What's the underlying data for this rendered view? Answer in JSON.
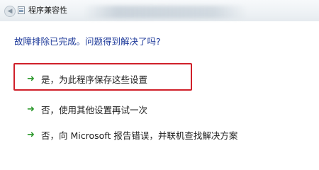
{
  "window": {
    "title": "程序兼容性"
  },
  "dialog": {
    "question": "故障排除已完成。问题得到解决了吗?",
    "options": [
      {
        "label": "是，为此程序保存这些设置",
        "icon": "green-arrow-icon",
        "highlighted": true
      },
      {
        "label": "否，使用其他设置再试一次",
        "icon": "green-arrow-icon"
      },
      {
        "label": "否，向 Microsoft 报告错误，并联机查找解决方案",
        "icon": "green-arrow-icon"
      }
    ]
  },
  "colors": {
    "question_text": "#1e3a9a",
    "arrow": "#2f9a2f",
    "highlight_border": "#d0202a"
  }
}
